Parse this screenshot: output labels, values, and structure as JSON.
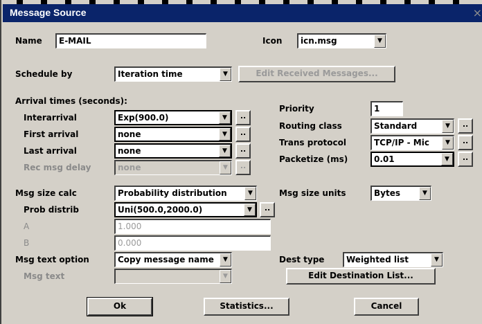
{
  "window": {
    "title": "Message Source",
    "close_glyph": "×"
  },
  "name": {
    "label": "Name",
    "value": "E-MAIL"
  },
  "icon": {
    "label": "Icon",
    "value": "icn.msg"
  },
  "schedule": {
    "label": "Schedule by",
    "value": "Iteration time",
    "edit_button": "Edit Received Messages..."
  },
  "arrival": {
    "header": "Arrival times (seconds):",
    "interarrival": {
      "label": "Interarrival",
      "value": "Exp(900.0)"
    },
    "first": {
      "label": "First arrival",
      "value": "none"
    },
    "last": {
      "label": "Last arrival",
      "value": "none"
    },
    "rec_delay": {
      "label": "Rec msg delay",
      "value": "none"
    }
  },
  "priority": {
    "label": "Priority",
    "value": "1"
  },
  "routing": {
    "label": "Routing class",
    "value": "Standard"
  },
  "protocol": {
    "label": "Trans protocol",
    "value": "TCP/IP - Mic"
  },
  "packetize": {
    "label": "Packetize (ms)",
    "value": "0.01"
  },
  "msgsize": {
    "label": "Msg size calc",
    "value": "Probability distribution",
    "units_label": "Msg size units",
    "units_value": "Bytes",
    "prob_label": "Prob distrib",
    "prob_value": "Uni(500.0,2000.0)",
    "a_label": "A",
    "a_value": "1.000",
    "b_label": "B",
    "b_value": "0.000"
  },
  "msgtext": {
    "label": "Msg text option",
    "value": "Copy message name",
    "text_label": "Msg text",
    "text_value": ""
  },
  "dest": {
    "label": "Dest type",
    "value": "Weighted list",
    "edit_button": "Edit Destination List..."
  },
  "buttons": {
    "ok": "Ok",
    "stats": "Statistics...",
    "cancel": "Cancel",
    "ellipsis": ".."
  },
  "arrow": "▼"
}
